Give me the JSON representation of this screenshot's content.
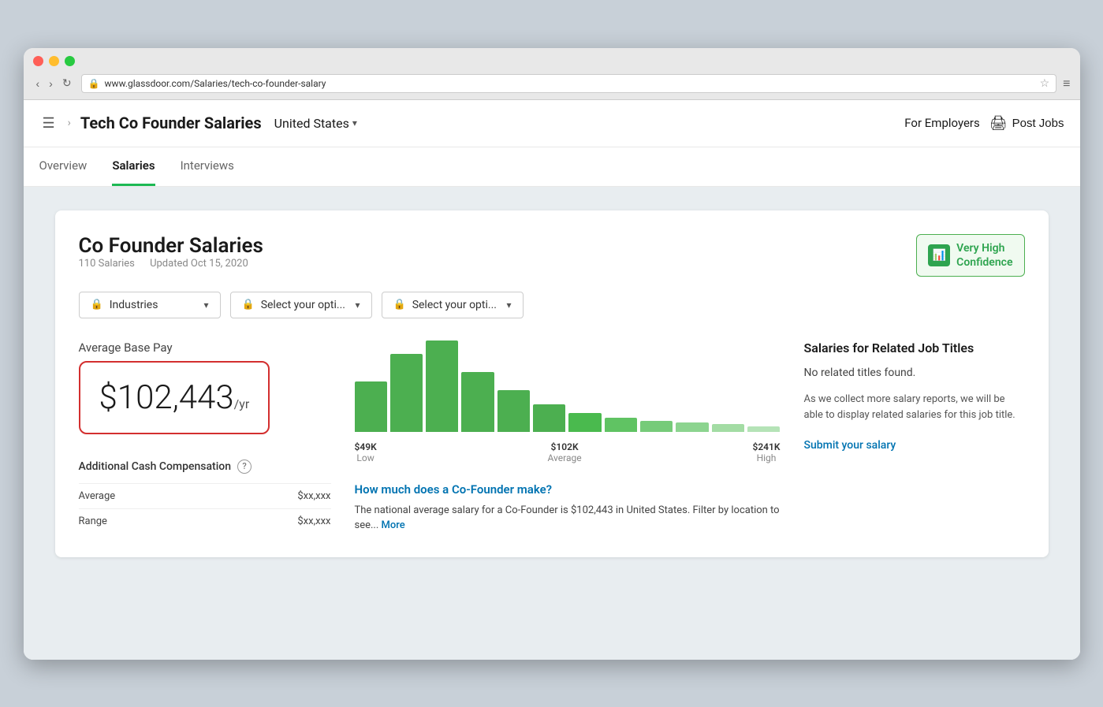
{
  "browser": {
    "address": "www.glassdoor.com/Salaries/tech-co-founder-salary",
    "traffic_lights": [
      "red",
      "yellow",
      "green"
    ]
  },
  "nav": {
    "hamburger_label": "☰",
    "breadcrumb_arrow": "›",
    "page_title": "Tech Co Founder Salaries",
    "location": "United States",
    "location_chevron": "▾",
    "for_employers": "For Employers",
    "post_jobs": "Post Jobs"
  },
  "tabs": [
    {
      "label": "Overview",
      "active": false
    },
    {
      "label": "Salaries",
      "active": true
    },
    {
      "label": "Interviews",
      "active": false
    }
  ],
  "card": {
    "title": "Co Founder Salaries",
    "salaries_count": "110 Salaries",
    "updated": "Updated Oct 15, 2020",
    "confidence": {
      "level": "Very High",
      "sub": "Confidence"
    }
  },
  "filters": [
    {
      "icon": "🔒",
      "label": "Industries",
      "id": "industries"
    },
    {
      "icon": "🔒",
      "label": "Select your opti...",
      "id": "option1"
    },
    {
      "icon": "🔒",
      "label": "Select your opti...",
      "id": "option2"
    }
  ],
  "avg_pay": {
    "label": "Average Base Pay",
    "amount": "$102,443",
    "unit": "/yr"
  },
  "additional_cash": {
    "title": "Additional Cash Compensation",
    "rows": [
      {
        "label": "Average",
        "value": "$xx,xxx"
      },
      {
        "label": "Range",
        "value": "$xx,xxx"
      }
    ]
  },
  "chart": {
    "bars": [
      55,
      85,
      100,
      65,
      45,
      30,
      20,
      15,
      12,
      10,
      8,
      6
    ],
    "labels": [
      {
        "amount": "$49K",
        "desc": "Low"
      },
      {
        "amount": "$102K",
        "desc": "Average"
      },
      {
        "amount": "$241K",
        "desc": "High"
      }
    ]
  },
  "faq": {
    "question": "How much does a Co-Founder make?",
    "answer": "The national average salary for a Co-Founder is $102,443 in United States. Filter by location to see...",
    "more": "More"
  },
  "related": {
    "title": "Salaries for Related Job Titles",
    "no_results": "No related titles found.",
    "description": "As we collect more salary reports, we will be able to display related salaries for this job title.",
    "submit_link": "Submit your salary"
  }
}
